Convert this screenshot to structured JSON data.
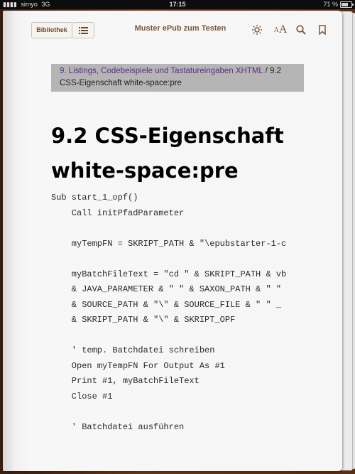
{
  "status": {
    "carrier": "simyo",
    "network": "3G",
    "time": "17:15",
    "battery_text": "71 %",
    "battery_level": 0.71
  },
  "toolbar": {
    "library_label": "Bibliothek",
    "book_title": "Muster ePub zum Testen",
    "font_small": "A",
    "font_big": "A"
  },
  "breadcrumb": {
    "chapter_link": "9. Listings, Codebeispiele und Tastatureingaben XHTML",
    "separator": " / ",
    "section": "9.2",
    "section_title": "CSS-Eigenschaft white-space:pre"
  },
  "heading": {
    "line1": "9.2 CSS-Eigenschaft",
    "line2": "white-space:pre"
  },
  "code_lines": [
    "Sub start_1_opf()",
    "    Call initPfadParameter",
    "",
    "    myTempFN = SKRIPT_PATH & \"\\epubstarter-1-c",
    "",
    "    myBatchFileText = \"cd \" & SKRIPT_PATH & vb",
    "    & JAVA_PARAMETER & \" \" & SAXON_PATH & \" \"",
    "    & SOURCE_PATH & \"\\\" & SOURCE_FILE & \" \" _",
    "    & SKRIPT_PATH & \"\\\" & SKRIPT_OPF",
    "",
    "    ' temp. Batchdatei schreiben",
    "    Open myTempFN For Output As #1",
    "    Print #1, myBatchFileText",
    "    Close #1",
    "",
    "    ' Batchdatei ausführen"
  ]
}
